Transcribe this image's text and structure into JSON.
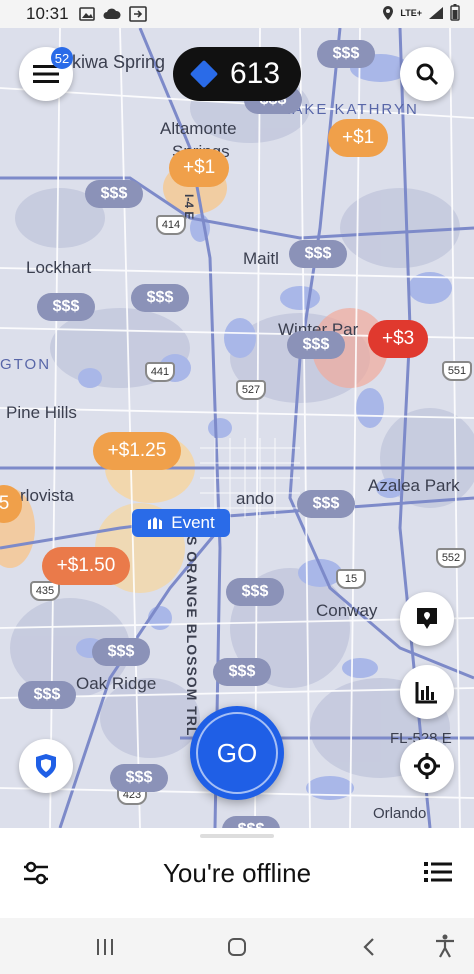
{
  "status_bar": {
    "time": "10:31",
    "network": "LTE+",
    "icons": [
      "image-icon",
      "cloud-icon",
      "cast-icon",
      "location-icon",
      "signal-icon",
      "battery-icon"
    ]
  },
  "top": {
    "menu_badge": "52",
    "points": "613"
  },
  "map": {
    "places": {
      "ekiwa": "ekiwa Spring",
      "altamonte": "Altamonte",
      "springs": "Springs",
      "lake_kathryn": "LAKE KATHRYN",
      "lockhart": "Lockhart",
      "maitland": "Maitl",
      "winter_park": "Winter Par",
      "gton": "GTON",
      "pine_hills": "Pine Hills",
      "orlovista": "rlovista",
      "orlando_partial": "ando",
      "azalea_park": "Azalea Park",
      "conway": "Conway",
      "oak_ridge": "Oak Ridge",
      "orlando": "Orlando",
      "i4e": "I-4 E",
      "orange_blossom": "S ORANGE BLOSSOM TRL",
      "fl528": "FL-528 E"
    },
    "highways": {
      "h414": "414",
      "h441": "441",
      "h527": "527",
      "h435": "435",
      "h15": "15",
      "h552": "552",
      "h551": "551",
      "h423": "423"
    },
    "price_label": "$$$",
    "surges": {
      "s1a": "+$1",
      "s1b": "+$1",
      "s3": "+$3",
      "s125": "+$1.25",
      "s150": "+$1.50",
      "s5": "5"
    },
    "event_label": "Event"
  },
  "go_label": "GO",
  "bottom": {
    "status": "You're offline"
  },
  "colors": {
    "accent": "#1f5fe6",
    "price_bubble": "#8b92b8",
    "surge_red": "#e0392e",
    "surge_orange": "#f0a04a"
  }
}
